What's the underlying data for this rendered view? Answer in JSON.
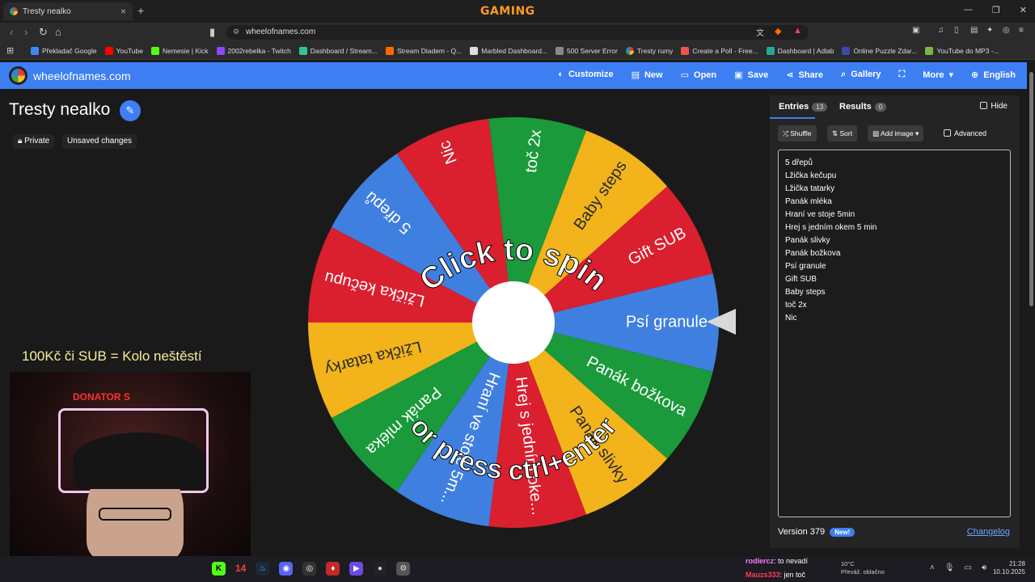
{
  "browser": {
    "tab_title": "Tresty nealko",
    "url": "wheelofnames.com",
    "overlay_brand": "GAMING",
    "bookmarks": [
      "Překladač Google",
      "YouTube",
      "Nemesie | Kick",
      "2002rebelka - Twitch",
      "Dashboard / Stream...",
      "Stream Diadem - Q...",
      "Marbled Dashboard...",
      "500 Server Error",
      "Tresty rumy",
      "Create a Poll - Free...",
      "Dashboard | Adlab",
      "Online Puzzle Zdar...",
      "YouTube do MP3 -..."
    ]
  },
  "app": {
    "site_name": "wheelofnames.com",
    "menu": [
      "Customize",
      "New",
      "Open",
      "Save",
      "Share",
      "Gallery",
      "More",
      "English"
    ],
    "title": "Tresty nealko",
    "private_label": "Private",
    "unsaved_label": "Unsaved changes"
  },
  "wheel": {
    "line1": "Click to spin",
    "line2": "or press ctrl+enter",
    "segments": [
      {
        "label": "Psí granule",
        "color": "#3f7fe0"
      },
      {
        "label": "Panák božkova",
        "color": "#1a9a3a"
      },
      {
        "label": "Panák slivky",
        "color": "#f2b41a"
      },
      {
        "label": "Hrej s jedním oke...",
        "color": "#da1f2f"
      },
      {
        "label": "Hraní ve stoje 5m...",
        "color": "#3f7fe0"
      },
      {
        "label": "Panák mléka",
        "color": "#1a9a3a"
      },
      {
        "label": "Lžička tatarky",
        "color": "#f2b41a"
      },
      {
        "label": "Lžička kečupu",
        "color": "#da1f2f"
      },
      {
        "label": "5 dřepů",
        "color": "#3f7fe0"
      },
      {
        "label": "Nic",
        "color": "#da1f2f"
      },
      {
        "label": "toč 2x",
        "color": "#1a9a3a"
      },
      {
        "label": "Baby steps",
        "color": "#f2b41a"
      },
      {
        "label": "Gift SUB",
        "color": "#da1f2f"
      }
    ]
  },
  "stream": {
    "overlay_text": "100Kč či SUB = Kolo neštěstí",
    "webcam_banner": "DONATOR S"
  },
  "panel": {
    "entries_tab": "Entries",
    "entries_count": "13",
    "results_tab": "Results",
    "results_count": "0",
    "hide_label": "Hide",
    "shuffle_label": "Shuffle",
    "sort_label": "Sort",
    "add_image_label": "Add image",
    "advanced_label": "Advanced",
    "entries": [
      "5 dřepů",
      "Lžička kečupu",
      "Lžička tatarky",
      "Panák mléka",
      "Hraní ve stoje 5min",
      "Hrej s jedním okem 5 min",
      "Panák slivky",
      "Panák božkova",
      "Psí granule",
      "Gift SUB",
      "Baby steps",
      "toč 2x",
      "Nic"
    ],
    "version": "Version 379",
    "new_badge": "New!",
    "changelog": "Changelog"
  },
  "taskbar": {
    "badge_count": "14",
    "chat": [
      {
        "user": "rodlercz",
        "message": ": to nevadí",
        "color": "#ff77ff"
      },
      {
        "user": "Mauzs333",
        "message": ": jen toč",
        "color": "#ff3b5c"
      }
    ],
    "weather_temp": "10°C",
    "weather_desc": "Převáž. oblačno",
    "time": "21:28",
    "date": "10.10.2025"
  }
}
